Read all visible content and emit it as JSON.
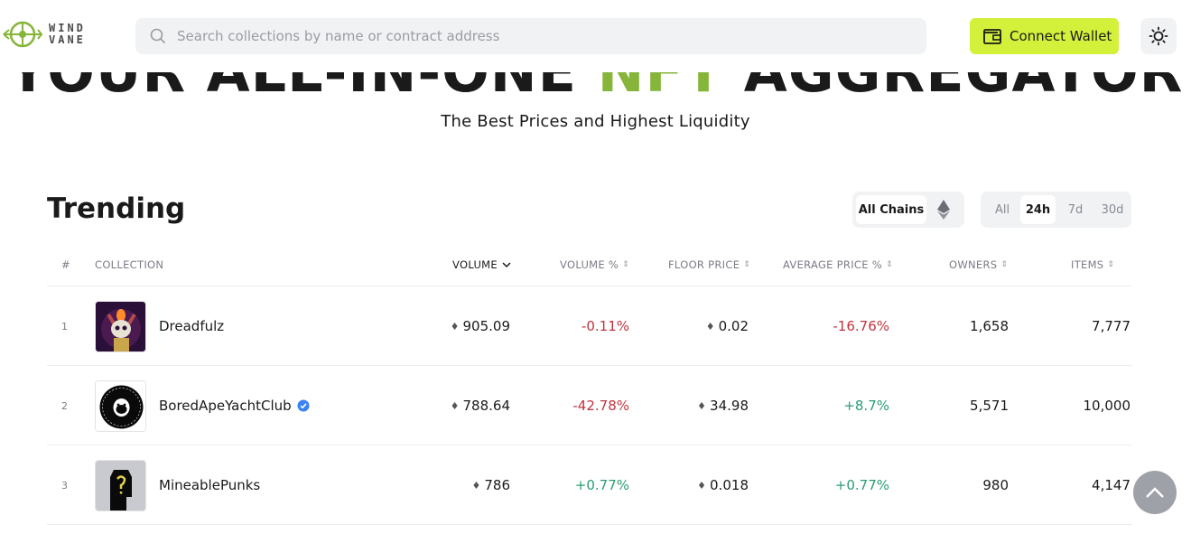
{
  "header": {
    "logo_line1": "WIND",
    "logo_line2": "VANE",
    "search_placeholder": "Search collections by name or contract address",
    "connect_label": "Connect Wallet"
  },
  "hero": {
    "title_prefix": "YOUR ALL-IN-ONE ",
    "title_accent": "NFT",
    "title_suffix": " AGGREGATOR",
    "subtitle": "The Best Prices and Highest Liquidity"
  },
  "trending": {
    "title": "Trending",
    "chain_all": "All Chains",
    "periods": [
      "All",
      "24h",
      "7d",
      "30d"
    ],
    "active_period": "24h",
    "columns": {
      "rank": "#",
      "collection": "COLLECTION",
      "volume": "VOLUME",
      "volume_pct": "VOLUME %",
      "floor": "FLOOR PRICE",
      "avg_pct": "AVERAGE PRICE %",
      "owners": "OWNERS",
      "items": "ITEMS"
    },
    "rows": [
      {
        "rank": "1",
        "name": "Dreadfulz",
        "verified": false,
        "volume": "905.09",
        "volume_pct": "-0.11%",
        "floor": "0.02",
        "avg_pct": "-16.76%",
        "owners": "1,658",
        "items": "7,777"
      },
      {
        "rank": "2",
        "name": "BoredApeYachtClub",
        "verified": true,
        "volume": "788.64",
        "volume_pct": "-42.78%",
        "floor": "34.98",
        "avg_pct": "+8.7%",
        "owners": "5,571",
        "items": "10,000"
      },
      {
        "rank": "3",
        "name": "MineablePunks",
        "verified": false,
        "volume": "786",
        "volume_pct": "+0.77%",
        "floor": "0.018",
        "avg_pct": "+0.77%",
        "owners": "980",
        "items": "4,147"
      }
    ]
  },
  "colors": {
    "accent": "#d3f03a",
    "nft_green": "#86b53a",
    "negative": "#c0343f",
    "positive": "#2a9d72"
  },
  "icons": [
    "windvane-logo-icon",
    "search-icon",
    "wallet-icon",
    "sun-icon",
    "ethereum-icon",
    "sort-icon",
    "verified-icon",
    "chevron-up-icon"
  ]
}
